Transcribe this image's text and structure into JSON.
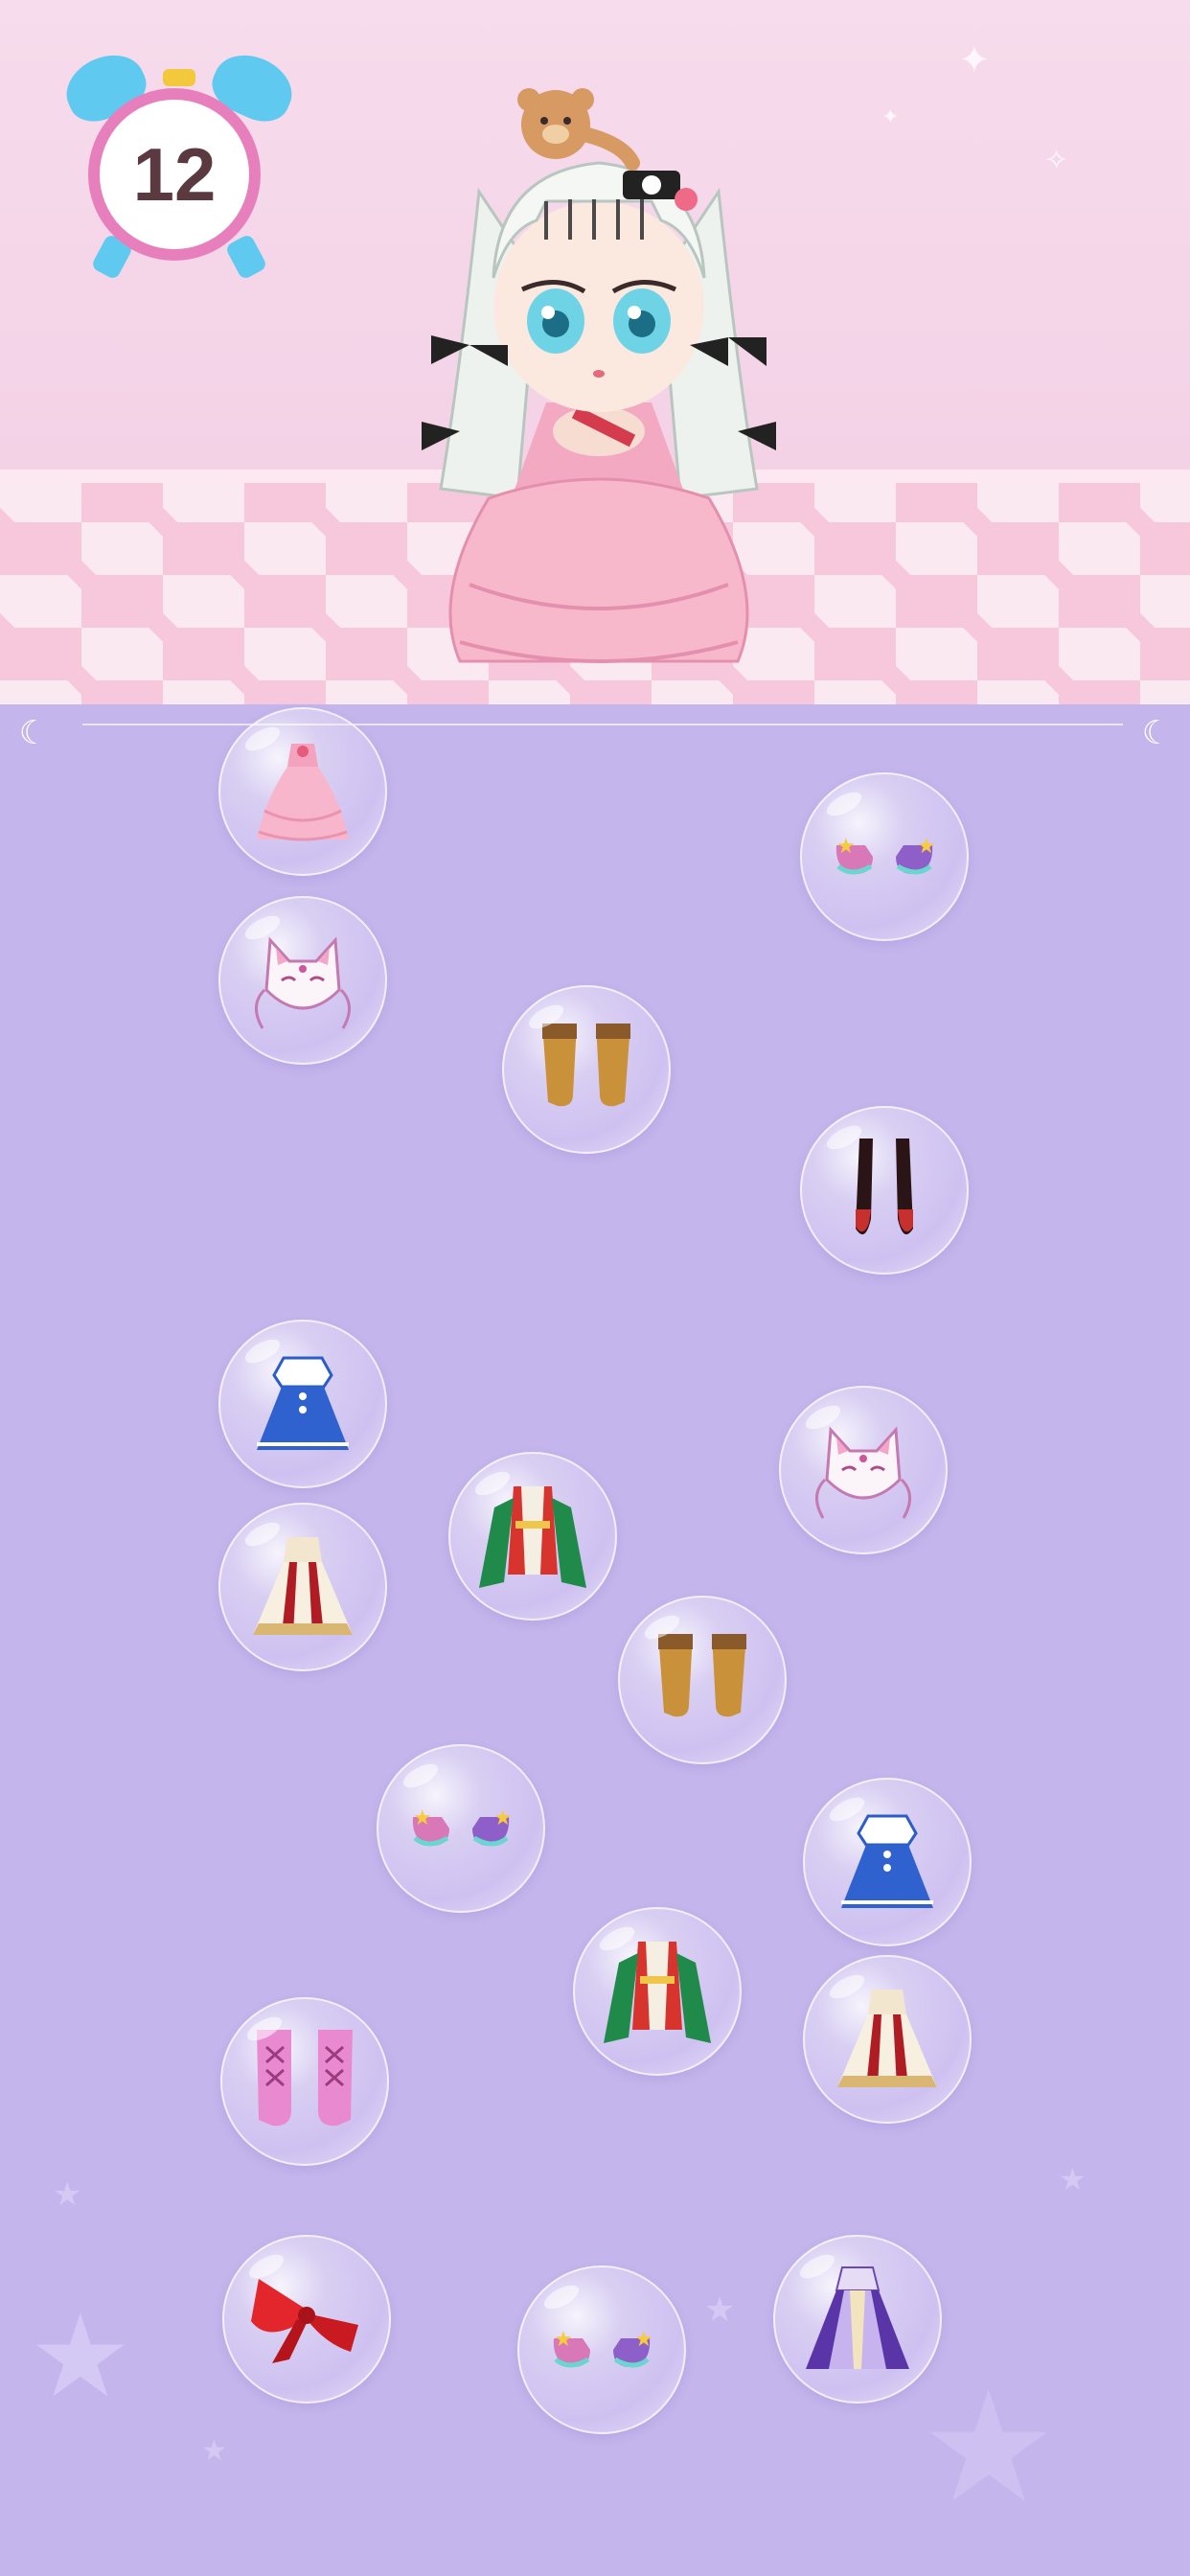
{
  "hud": {
    "timer_value": "12"
  },
  "colors": {
    "panel_bg": "#c4b5ec",
    "timer_ring": "#e87fbd",
    "timer_bells": "#5fc9f0",
    "stage_bg": "#f6dcec"
  },
  "character": {
    "name": "doll"
  },
  "items": [
    {
      "id": "pink-gown",
      "icon": "pink-gown-icon"
    },
    {
      "id": "purple-shoes",
      "icon": "purple-shoes-icon"
    },
    {
      "id": "fox-mask",
      "icon": "fox-mask-icon"
    },
    {
      "id": "tan-boots",
      "icon": "tan-boots-icon"
    },
    {
      "id": "black-red-stockings",
      "icon": "black-red-stockings-icon"
    },
    {
      "id": "blue-sailor-dress",
      "icon": "blue-sailor-dress-icon"
    },
    {
      "id": "fox-mask-2",
      "icon": "fox-mask-icon"
    },
    {
      "id": "red-green-hanfu",
      "icon": "hanfu-icon"
    },
    {
      "id": "gold-red-gown",
      "icon": "gold-red-gown-icon"
    },
    {
      "id": "tan-boots-2",
      "icon": "tan-boots-icon"
    },
    {
      "id": "purple-shoes-2",
      "icon": "purple-shoes-icon"
    },
    {
      "id": "blue-sailor-dress-2",
      "icon": "blue-sailor-dress-icon"
    },
    {
      "id": "red-green-hanfu-2",
      "icon": "hanfu-icon"
    },
    {
      "id": "gold-red-gown-2",
      "icon": "gold-red-gown-icon"
    },
    {
      "id": "pink-lace-boots",
      "icon": "pink-boots-icon"
    },
    {
      "id": "red-bow",
      "icon": "red-bow-icon"
    },
    {
      "id": "purple-shoes-3",
      "icon": "purple-shoes-icon"
    },
    {
      "id": "lavender-robe",
      "icon": "lavender-robe-icon"
    }
  ]
}
